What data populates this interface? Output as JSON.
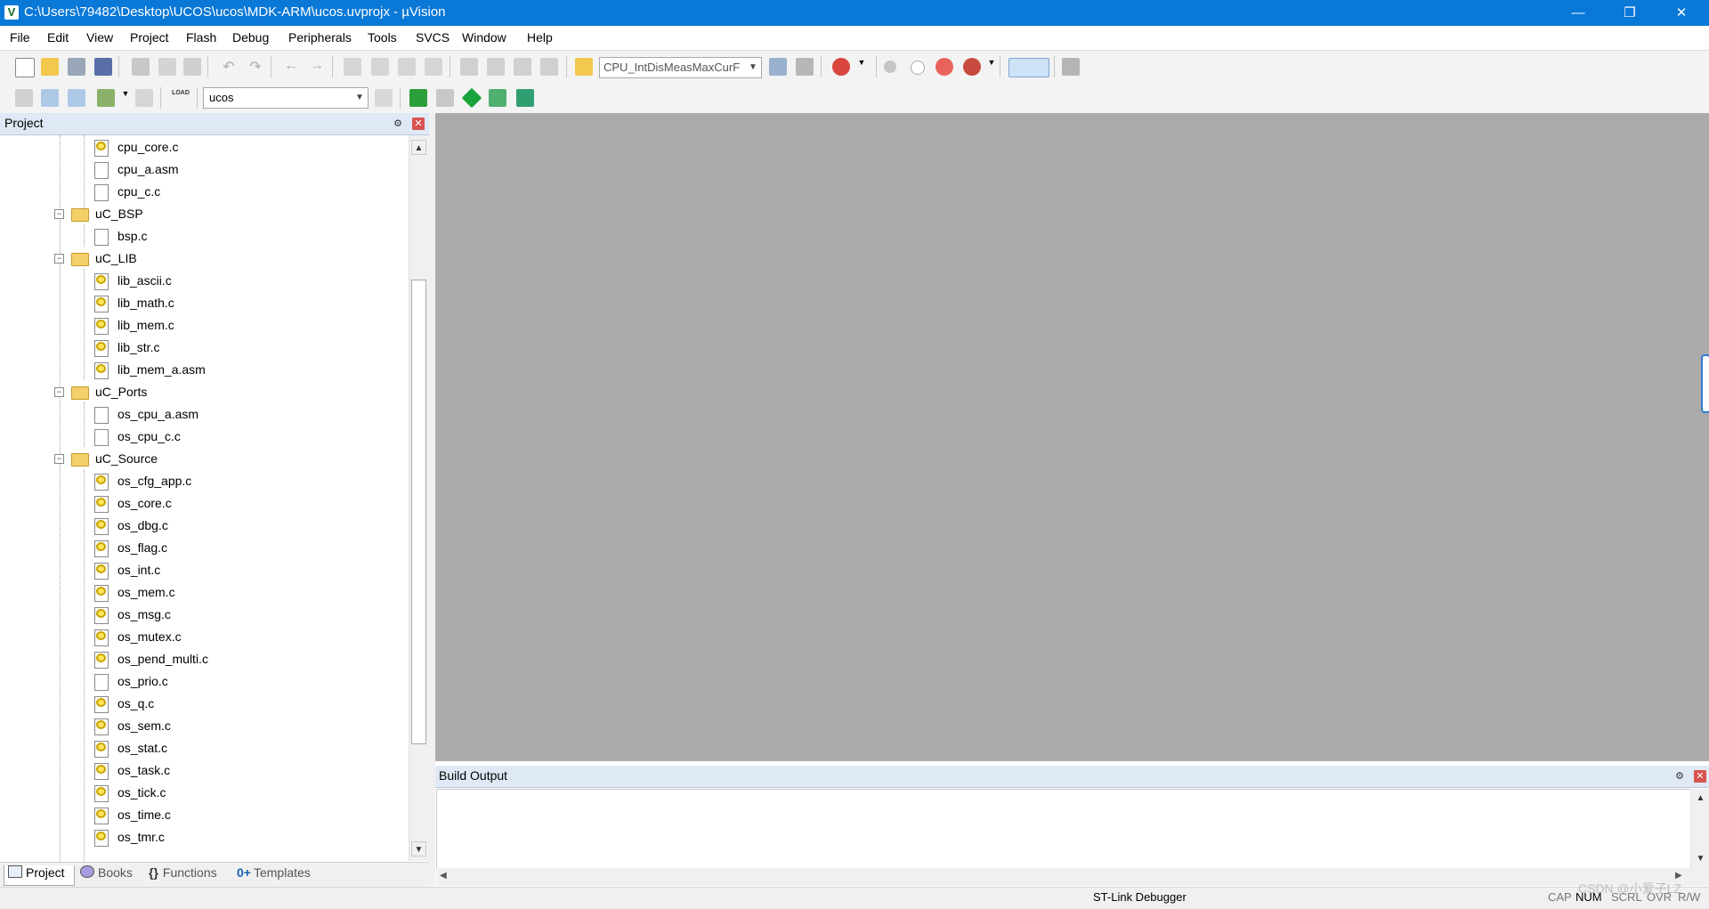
{
  "window": {
    "title": "C:\\Users\\79482\\Desktop\\UCOS\\ucos\\MDK-ARM\\ucos.uvprojx - µVision",
    "app_icon": "V"
  },
  "menu": [
    "File",
    "Edit",
    "View",
    "Project",
    "Flash",
    "Debug",
    "Peripherals",
    "Tools",
    "SVCS",
    "Window",
    "Help"
  ],
  "toolbar1": {
    "find_combo_value": "CPU_IntDisMeasMaxCurF"
  },
  "toolbar2": {
    "target_combo_value": "ucos",
    "load_label": "LOAD"
  },
  "project_panel": {
    "title": "Project",
    "tree": [
      {
        "label": "cpu_core.c",
        "type": "file",
        "key": true
      },
      {
        "label": "cpu_a.asm",
        "type": "file",
        "key": false
      },
      {
        "label": "cpu_c.c",
        "type": "file",
        "key": false
      },
      {
        "label": "uC_BSP",
        "type": "group"
      },
      {
        "label": "bsp.c",
        "type": "file",
        "key": false
      },
      {
        "label": "uC_LIB",
        "type": "group"
      },
      {
        "label": "lib_ascii.c",
        "type": "file",
        "key": true
      },
      {
        "label": "lib_math.c",
        "type": "file",
        "key": true
      },
      {
        "label": "lib_mem.c",
        "type": "file",
        "key": true
      },
      {
        "label": "lib_str.c",
        "type": "file",
        "key": true
      },
      {
        "label": "lib_mem_a.asm",
        "type": "file",
        "key": true
      },
      {
        "label": "uC_Ports",
        "type": "group"
      },
      {
        "label": "os_cpu_a.asm",
        "type": "file",
        "key": false
      },
      {
        "label": "os_cpu_c.c",
        "type": "file",
        "key": false
      },
      {
        "label": "uC_Source",
        "type": "group"
      },
      {
        "label": "os_cfg_app.c",
        "type": "file",
        "key": true
      },
      {
        "label": "os_core.c",
        "type": "file",
        "key": true
      },
      {
        "label": "os_dbg.c",
        "type": "file",
        "key": true
      },
      {
        "label": "os_flag.c",
        "type": "file",
        "key": true
      },
      {
        "label": "os_int.c",
        "type": "file",
        "key": true
      },
      {
        "label": "os_mem.c",
        "type": "file",
        "key": true
      },
      {
        "label": "os_msg.c",
        "type": "file",
        "key": true
      },
      {
        "label": "os_mutex.c",
        "type": "file",
        "key": true
      },
      {
        "label": "os_pend_multi.c",
        "type": "file",
        "key": true
      },
      {
        "label": "os_prio.c",
        "type": "file",
        "key": false
      },
      {
        "label": "os_q.c",
        "type": "file",
        "key": true
      },
      {
        "label": "os_sem.c",
        "type": "file",
        "key": true
      },
      {
        "label": "os_stat.c",
        "type": "file",
        "key": true
      },
      {
        "label": "os_task.c",
        "type": "file",
        "key": true
      },
      {
        "label": "os_tick.c",
        "type": "file",
        "key": true
      },
      {
        "label": "os_time.c",
        "type": "file",
        "key": true
      },
      {
        "label": "os_tmr.c",
        "type": "file",
        "key": true
      }
    ],
    "tabs": [
      {
        "label": "Project",
        "icon": "project-icon"
      },
      {
        "label": "Books",
        "icon": "books-icon"
      },
      {
        "label": "Functions",
        "icon": "functions-icon"
      },
      {
        "label": "Templates",
        "icon": "templates-icon"
      }
    ]
  },
  "build_output": {
    "title": "Build Output"
  },
  "status": {
    "debugger": "ST-Link Debugger",
    "cap": "CAP",
    "num": "NUM",
    "scrl": "SCRL",
    "ovr": "OVR",
    "rw": "R/W"
  },
  "watermark": "CSDN @小爱子LZ"
}
